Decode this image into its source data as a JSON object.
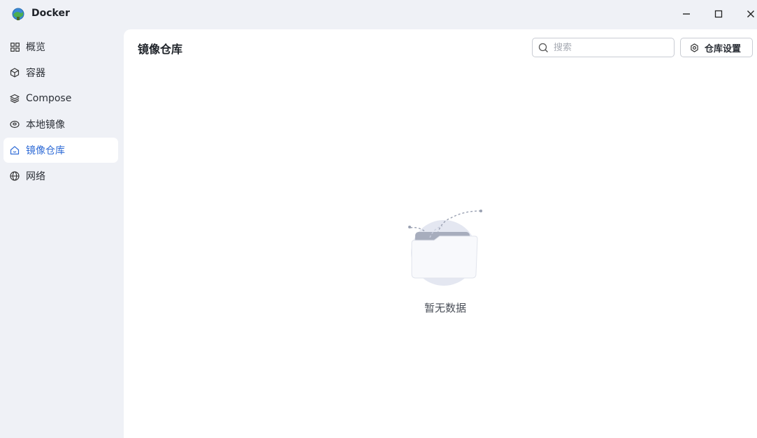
{
  "window": {
    "title": "Docker"
  },
  "sidebar": {
    "items": [
      {
        "label": "概览",
        "icon": "grid-icon",
        "active": false
      },
      {
        "label": "容器",
        "icon": "cube-icon",
        "active": false
      },
      {
        "label": "Compose",
        "icon": "layers-icon",
        "active": false
      },
      {
        "label": "本地镜像",
        "icon": "disk-icon",
        "active": false
      },
      {
        "label": "镜像仓库",
        "icon": "home-icon",
        "active": true
      },
      {
        "label": "网络",
        "icon": "globe-icon",
        "active": false
      }
    ]
  },
  "main": {
    "title": "镜像仓库",
    "search": {
      "placeholder": "搜索",
      "value": ""
    },
    "settings_button": "仓库设置",
    "empty_text": "暂无数据"
  },
  "colors": {
    "accent": "#2f6bd6",
    "sidebar_bg": "#eff1f6",
    "content_bg": "#ffffff"
  }
}
